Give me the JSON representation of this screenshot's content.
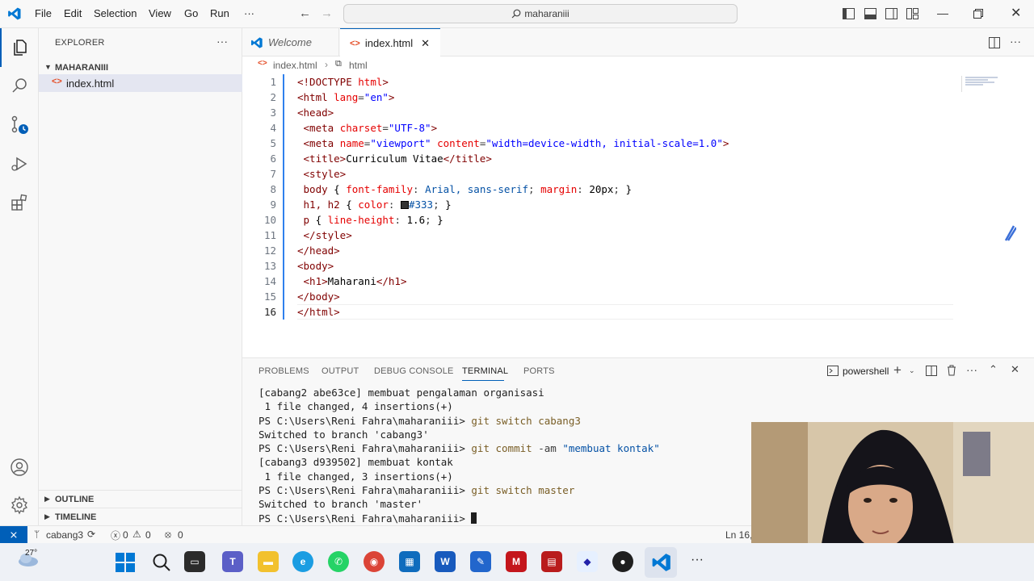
{
  "titlebar": {
    "menu": [
      "File",
      "Edit",
      "Selection",
      "View",
      "Go",
      "Run",
      "···"
    ],
    "search_text": "maharaniii"
  },
  "sidebar": {
    "title": "EXPLORER",
    "folder": "MAHARANIII",
    "file": "index.html",
    "outline": "OUTLINE",
    "timeline": "TIMELINE"
  },
  "tabs": [
    {
      "label": "Welcome",
      "active": false
    },
    {
      "label": "index.html",
      "active": true
    }
  ],
  "breadcrumb": {
    "file": "index.html",
    "symbol": "html"
  },
  "editor": {
    "line_numbers": [
      "1",
      "2",
      "3",
      "4",
      "5",
      "6",
      "7",
      "8",
      "9",
      "10",
      "11",
      "12",
      "13",
      "14",
      "15",
      "16"
    ],
    "title_text": "Curriculum Vitae",
    "h1_text": "Maharani",
    "css_body_font": "Arial, sans-serif",
    "css_body_margin": "20px",
    "css_h_color": "#333",
    "css_p_lineheight": "1.6",
    "charset": "\"UTF-8\"",
    "lang": "\"en\"",
    "viewport_content": "\"width=device-width, initial-scale=1.0\"",
    "viewport_name": "\"viewport\""
  },
  "panel": {
    "tabs": [
      "PROBLEMS",
      "OUTPUT",
      "DEBUG CONSOLE",
      "TERMINAL",
      "PORTS"
    ],
    "active_tab": "TERMINAL",
    "shell": "powershell",
    "terminal_lines": [
      "[cabang2 abe63ce] membuat pengalaman organisasi",
      " 1 file changed, 4 insertions(+)",
      "PS C:\\Users\\Reni Fahra\\maharaniii> ",
      "Switched to branch 'cabang3'",
      "PS C:\\Users\\Reni Fahra\\maharaniii> ",
      "[cabang3 d939502] membuat kontak",
      " 1 file changed, 3 insertions(+)",
      "PS C:\\Users\\Reni Fahra\\maharaniii> ",
      "Switched to branch 'master'",
      "PS C:\\Users\\Reni Fahra\\maharaniii> "
    ],
    "cmd_switch_cabang3": "git switch cabang3",
    "cmd_commit": "git commit",
    "cmd_commit_flag": "-am",
    "cmd_commit_msg": "\"membuat kontak\"",
    "cmd_switch_master": "git switch master"
  },
  "statusbar": {
    "branch": "cabang3",
    "errors": "0",
    "warnings": "0",
    "ports": "0",
    "position": "Ln 16,"
  },
  "taskbar": {
    "temperature": "27°"
  },
  "colors": {
    "accent": "#005fb8",
    "tag": "#800000",
    "attr": "#e50000",
    "string": "#0000ff"
  }
}
